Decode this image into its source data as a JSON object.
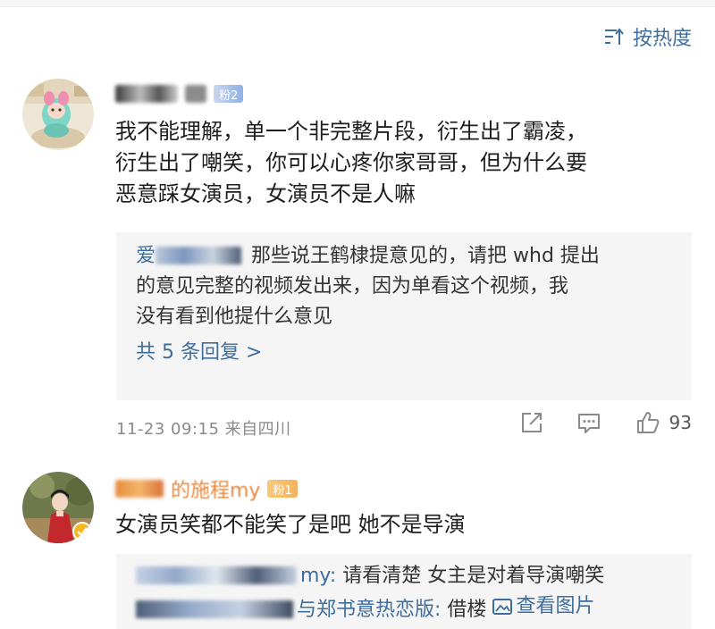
{
  "sort": {
    "label": "按热度",
    "icon": "sort-lines-icon"
  },
  "comments": [
    {
      "fan_badge": "粉2",
      "text_lines": [
        "我不能理解，单一个非完整片段，衍生出了霸凌，",
        "衍生出了嘲笑，你可以心疼你家哥哥，但为什么要",
        "恶意踩女演员，女演员不是人嘛"
      ],
      "reply": {
        "name_fragment": "爱",
        "text_lines": [
          "那些说王鹤棣提意见的，请把 whd 提出",
          "的意见完整的视频发出来，因为单看这个视频，我",
          "没有看到他提什么意见"
        ],
        "more_label": "共 5 条回复 >"
      },
      "meta": "11-23 09:15 来自四川",
      "like_count": "93"
    },
    {
      "name_fragment": "的施程my",
      "fan_badge": "粉1",
      "text_lines": [
        "女演员笑都不能笑了是吧 她不是导演"
      ],
      "replies": [
        {
          "name_suffix": "my:",
          "text": "请看清楚 女主是对着导演嘲笑"
        },
        {
          "name_suffix": "与郑书意热恋版:",
          "text": "借楼",
          "view_image_label": "查看图片"
        }
      ]
    }
  ],
  "colors": {
    "link": "#3f6d9e",
    "meta": "#8a8a8a",
    "reply_bg": "#f5f5f5",
    "fan_badge_1": "#8fb0e6",
    "fan_badge_2": "#f4b35e"
  }
}
